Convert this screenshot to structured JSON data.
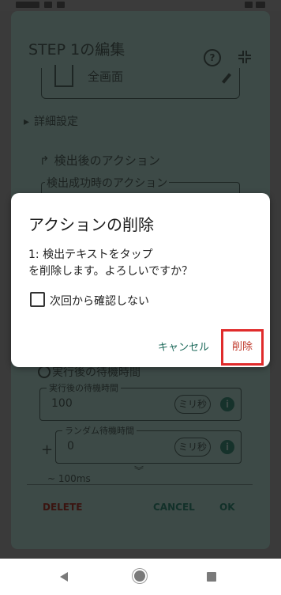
{
  "editor": {
    "title": "STEP 1の編集",
    "help_glyph": "?",
    "image_label": "全画面",
    "advanced_label": "詳細設定",
    "after_detect_header": "検出後のアクション",
    "on_success_legend": "検出成功時のアクション",
    "wait_section_label": "実行後の待機時間",
    "wait_after": {
      "legend": "実行後の待機時間",
      "value": "100",
      "unit": "ミリ秒"
    },
    "random_wait": {
      "legend": "ランダム待機時間",
      "value": "0",
      "unit": "ミリ秒",
      "prefix": "+"
    },
    "hint": "~ 100ms",
    "delete_button": "DELETE",
    "cancel_button": "CANCEL",
    "ok_button": "OK"
  },
  "dialog": {
    "title": "アクションの削除",
    "message_line1": "1: 検出テキストをタップ",
    "message_line2": "を削除します。よろしいですか？",
    "checkbox_label": "次回から確認しない",
    "checkbox_checked": false,
    "cancel_button": "キャンセル",
    "delete_button": "削除"
  },
  "colors": {
    "accent": "#1f6b5c",
    "danger": "#c0392b",
    "highlight": "#e02b2b"
  }
}
